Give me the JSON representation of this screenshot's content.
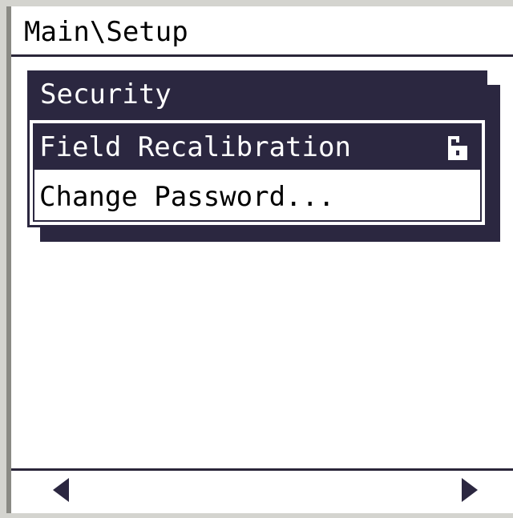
{
  "window": {
    "path_title": "Main\\Setup"
  },
  "menu": {
    "header": "Security",
    "items": [
      {
        "label": "Field Recalibration",
        "selected": true,
        "icon": "unlocked-padlock-icon"
      },
      {
        "label": "Change Password...",
        "selected": false,
        "icon": null
      }
    ]
  },
  "navigation": {
    "left_icon": "left-arrow-icon",
    "right_icon": "right-arrow-icon"
  },
  "colors": {
    "panel": "#2b2740",
    "background": "#ffffff",
    "frame": "#d4d4cf"
  }
}
